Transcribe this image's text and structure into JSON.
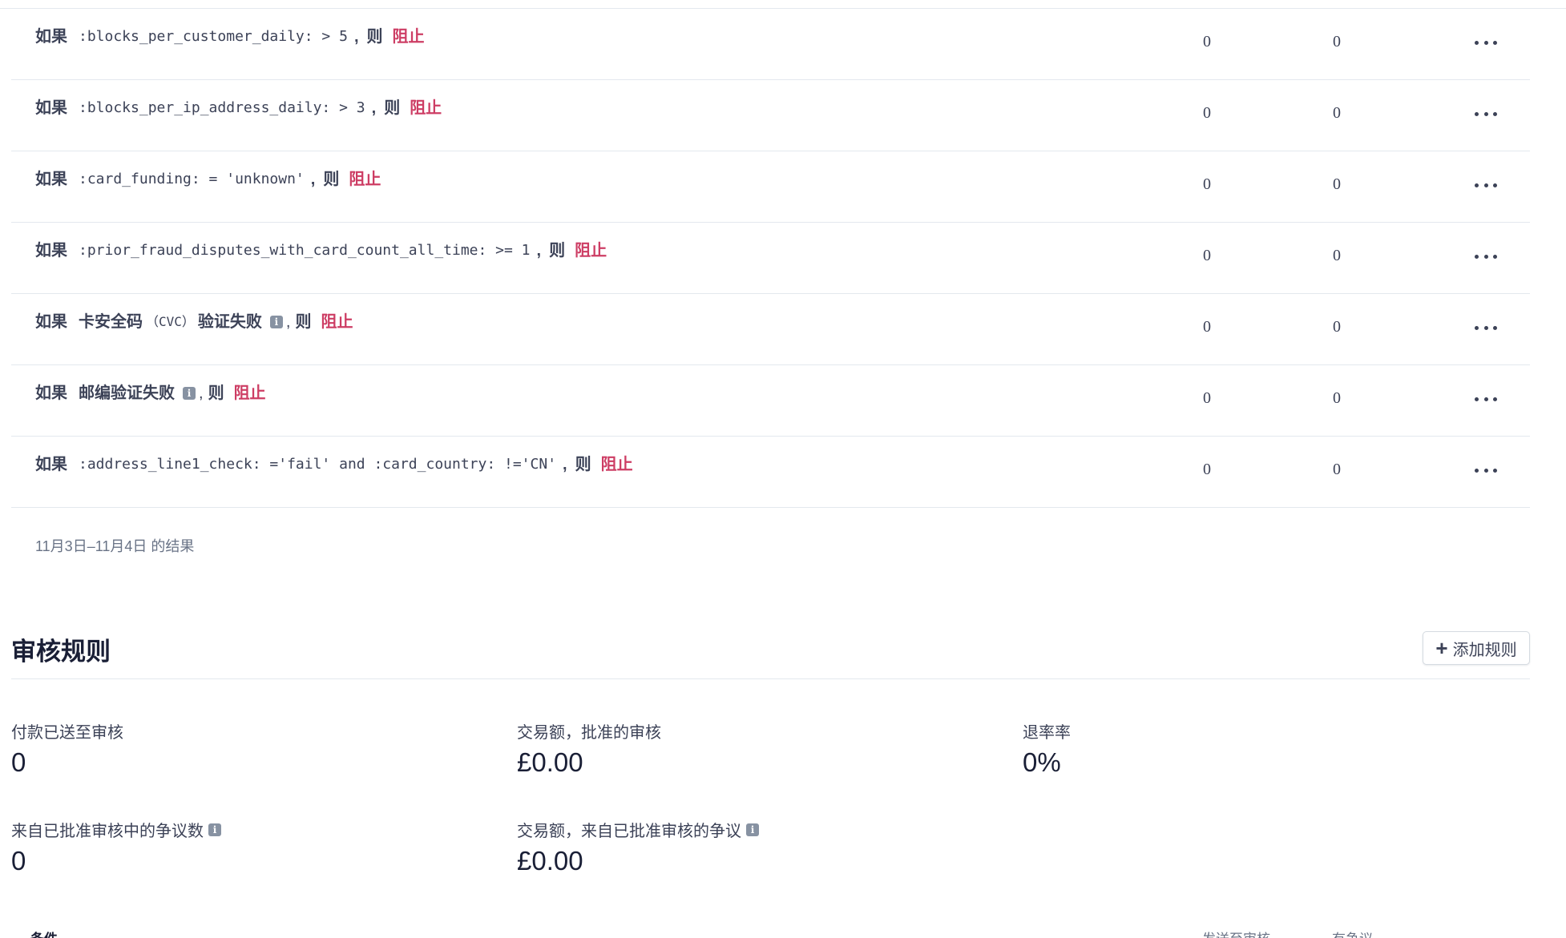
{
  "block_rules": {
    "if_keyword": "如果",
    "then_keyword": "则",
    "rows": [
      {
        "type": "code",
        "condition": ":blocks_per_customer_daily: > 5",
        "action": "阻止",
        "count_a": "0",
        "count_b": "0"
      },
      {
        "type": "code",
        "condition": ":blocks_per_ip_address_daily: > 3",
        "action": "阻止",
        "count_a": "0",
        "count_b": "0"
      },
      {
        "type": "code",
        "condition": ":card_funding: = 'unknown'",
        "action": "阻止",
        "count_a": "0",
        "count_b": "0"
      },
      {
        "type": "code",
        "condition": ":prior_fraud_disputes_with_card_count_all_time: >= 1",
        "action": "阻止",
        "count_a": "0",
        "count_b": "0"
      },
      {
        "type": "text_cvc",
        "condition_pre": "卡安全码",
        "condition_paren": "（CVC）",
        "condition_post": "验证失败",
        "action": "阻止",
        "count_a": "0",
        "count_b": "0"
      },
      {
        "type": "text",
        "condition": "邮编验证失败",
        "action": "阻止",
        "count_a": "0",
        "count_b": "0"
      },
      {
        "type": "code",
        "condition": ":address_line1_check: ='fail' and :card_country: !='CN'",
        "action": "阻止",
        "count_a": "0",
        "count_b": "0"
      }
    ],
    "results_note": "11月3日–11月4日 的结果"
  },
  "review_rules": {
    "title": "审核规则",
    "add_button_label": "添加规则",
    "metrics": {
      "sent_to_review_label": "付款已送至审核",
      "sent_to_review_value": "0",
      "approved_volume_label": "交易额，批准的审核",
      "approved_volume_value": "£0.00",
      "refund_rate_label": "退率率",
      "refund_rate_value": "0%",
      "disputes_count_label": "来自已批准审核中的争议数",
      "disputes_count_value": "0",
      "disputes_volume_label": "交易额，来自已批准审核的争议",
      "disputes_volume_value": "£0.00"
    },
    "table_header": {
      "condition": "条件",
      "sent_to_review": "发送至审核",
      "disputed": "有争议"
    }
  },
  "icons": {
    "info": "info-icon",
    "more": "more-horizontal-icon",
    "plus": "plus-icon"
  },
  "colors": {
    "action_block": "#cd3d64",
    "text": "#3c4257",
    "divider": "#e3e8ee"
  }
}
